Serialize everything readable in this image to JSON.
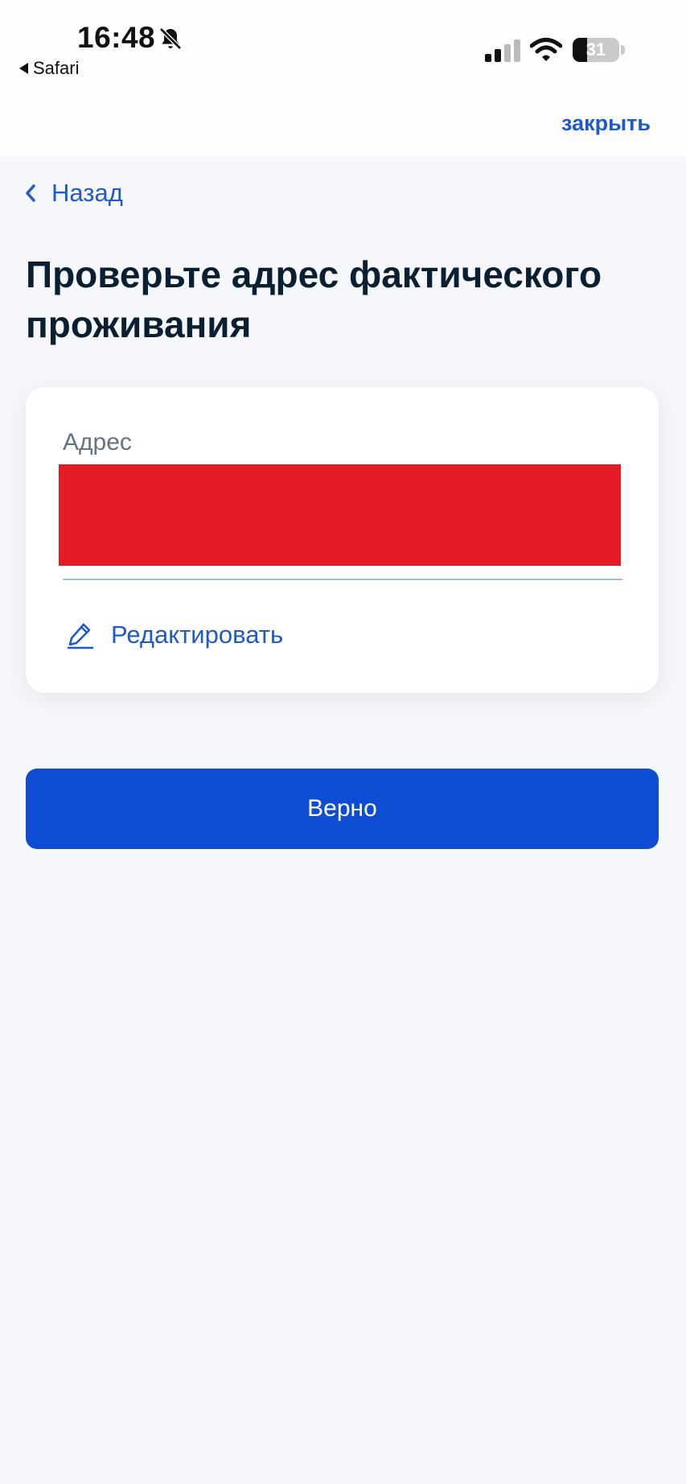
{
  "status_bar": {
    "time": "16:48",
    "back_app_label": "Safari",
    "battery_level": "31",
    "battery_fraction": 0.31,
    "icons": [
      "bell-slash-icon",
      "signal-icon",
      "wifi-icon",
      "battery-icon"
    ]
  },
  "header": {
    "close_label": "закрыть"
  },
  "nav": {
    "back_label": "Назад",
    "back_icon": "chevron-left-icon"
  },
  "page": {
    "title": "Проверьте адрес фактического проживания"
  },
  "address_card": {
    "label": "Адрес",
    "value_redacted": true,
    "redaction_color": "#e31b25",
    "edit_label": "Редактировать",
    "edit_icon": "pencil-icon"
  },
  "actions": {
    "confirm_label": "Верно"
  },
  "colors": {
    "accent": "#0d4cd3",
    "link": "#1f5ac9",
    "background": "#f5f7fb",
    "title": "#0b1f33"
  }
}
